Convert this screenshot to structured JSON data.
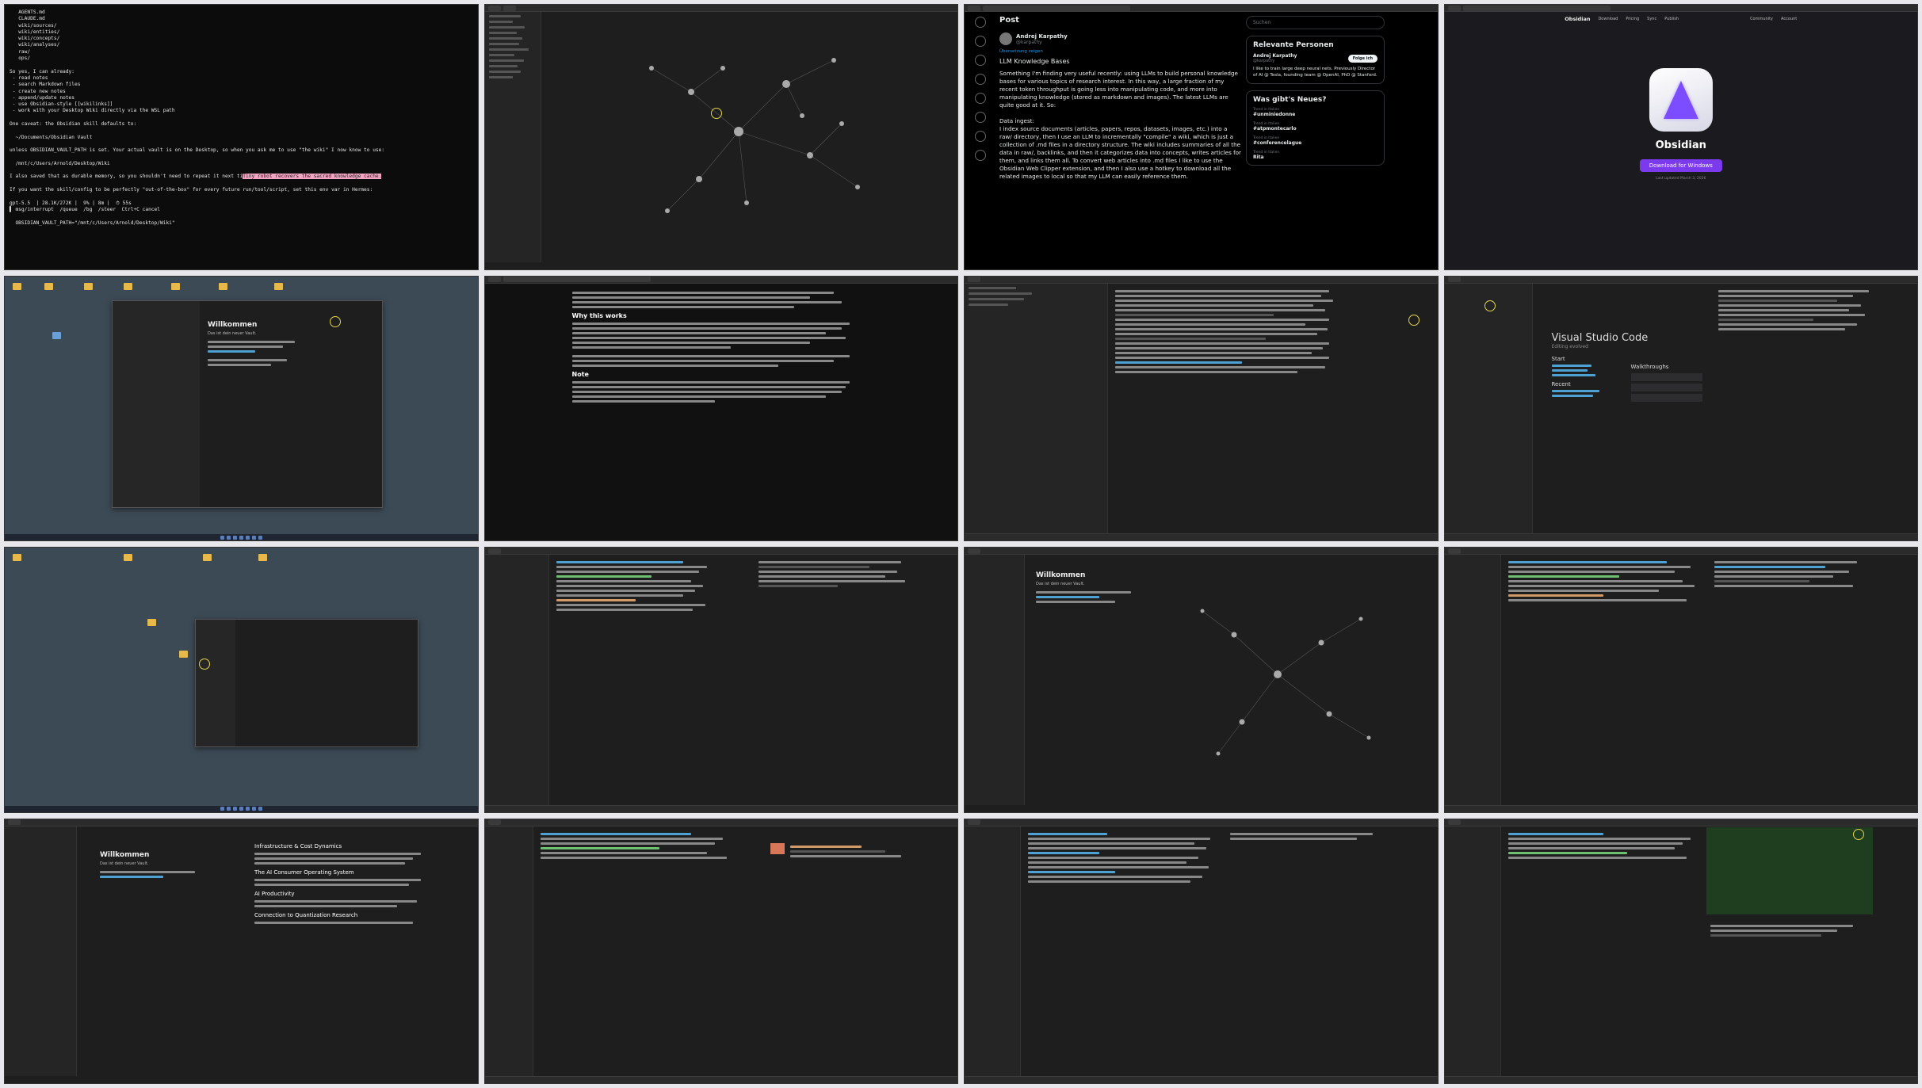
{
  "tiles": [
    {
      "id": "terminal",
      "lines": [
        "   AGENTS.md",
        "   CLAUDE.md",
        "   wiki/sources/",
        "   wiki/entities/",
        "   wiki/concepts/",
        "   wiki/analyses/",
        "   raw/",
        "   ops/",
        "",
        "So yes, I can already:",
        " - read notes",
        " - search Markdown files",
        " - create new notes",
        " - append/update notes",
        " - use Obsidian-style [[wikilinks]]",
        " - work with your Desktop Wiki directly via the WSL path",
        "",
        "One caveat: the Obsidian skill defaults to:",
        "",
        "  ~/Documents/Obsidian Vault",
        "",
        "unless OBSIDIAN_VAULT_PATH is set. Your actual vault is on the Desktop, so when you ask me to use \"the wiki\" I now know to use:",
        "",
        "  /mnt/c/Users/Arnold/Desktop/Wiki",
        ""
      ],
      "highlight_pre": "I also saved that as durable memory, so you shouldn't need to repeat it next ti",
      "highlight_text": "Tiny robot recovers the sacred knowledge cache.",
      "after": "If you want the skill/config to be perfectly \"out-of-the-box\" for every future run/tool/script, set this env var in Hermes:",
      "status": "gpt-5.5  | 28.1K/272K |  9% | 8m |  ⏱ 55s",
      "prompt": "▌ msg/interrupt  /queue  /bg  /steer  Ctrl+C cancel",
      "env_line": "  OBSIDIAN_VAULT_PATH=\"/mnt/c/Users/Arnold/Desktop/Wiki\""
    },
    {
      "id": "x-post",
      "header": "Post",
      "author": "Andrej Karpathy",
      "handle": "@karpathy",
      "translate": "Übersetzung zeigen",
      "title": "LLM Knowledge Bases",
      "para1": "Something I'm finding very useful recently: using LLMs to build personal knowledge bases for various topics of research interest. In this way, a large fraction of my recent token throughput is going less into manipulating code, and more into manipulating knowledge (stored as markdown and images). The latest LLMs are quite good at it. So:",
      "para2_head": "Data ingest:",
      "para2": "I index source documents (articles, papers, repos, datasets, images, etc.) into a raw/ directory, then I use an LLM to incrementally \"compile\" a wiki, which is just a collection of .md files in a directory structure. The wiki includes summaries of all the data in raw/, backlinks, and then it categorizes data into concepts, writes articles for them, and links them all. To convert web articles into .md files I like to use the Obsidian Web Clipper extension, and then I also use a hotkey to download all the related images to local so that my LLM can easily reference them.",
      "search_placeholder": "Suchen",
      "people_title": "Relevante Personen",
      "person_name": "Andrej Karpathy",
      "person_handle": "@karpathy",
      "follow": "Folge ich",
      "person_bio": "I like to train large deep neural nets. Previously Director of AI @ Tesla, founding team @ OpenAI, PhD @ Stanford.",
      "news_title": "Was gibt's Neues?",
      "trends": [
        {
          "meta": "Trend in Italien",
          "tag": "#unminiedonne"
        },
        {
          "meta": "Trend in Italien",
          "tag": "#atpmontecarlo"
        },
        {
          "meta": "Trend in Italien",
          "tag": "#conferencelague"
        },
        {
          "meta": "Trend in Italien",
          "tag": "Rita"
        }
      ]
    },
    {
      "id": "obsidian-site",
      "brand": "Obsidian",
      "nav": [
        "Download",
        "Pricing",
        "Sync",
        "Publish",
        "Community",
        "Account"
      ],
      "name": "Obsidian",
      "download": "Download for Windows",
      "updated": "Last updated March 3, 2026"
    },
    {
      "id": "vscode-welcome",
      "heading": "Visual Studio Code",
      "subheading": "Editing evolved",
      "start": "Start",
      "recent": "Recent",
      "walkthroughs": "Walkthroughs"
    },
    {
      "id": "obsidian-welcome",
      "heading": "Willkommen",
      "sub": "Das ist dein neuer Vault."
    },
    {
      "id": "article",
      "why": "Why this works",
      "note": "Note"
    },
    {
      "id": "article2",
      "h1": "Infrastructure & Cost Dynamics",
      "h2": "The AI Consumer Operating System",
      "h3": "AI Productivity",
      "h4": "Connection to Quantization Research"
    }
  ]
}
